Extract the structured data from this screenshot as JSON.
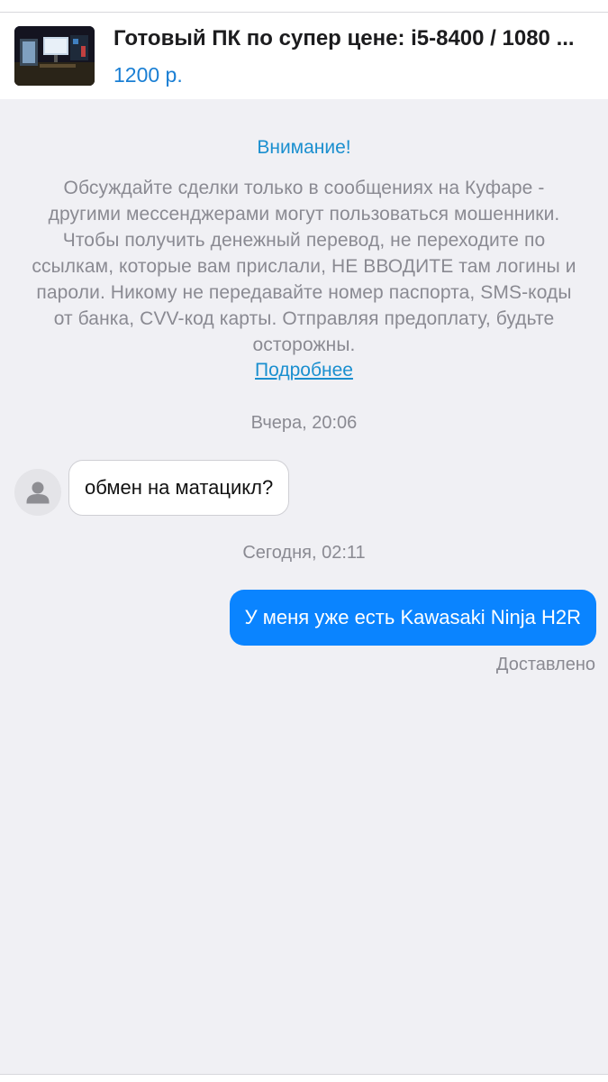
{
  "header": {
    "title": "Готовый ПК по супер цене: i5-8400 / 1080 ...",
    "price": "1200 р.",
    "thumbnail_icon": "listing-photo"
  },
  "notice": {
    "title": "Внимание!",
    "body": "Обсуждайте сделки только в сообщениях на Куфаре - другими мессенджерами могут пользоваться мошенники. Чтобы получить денежный перевод, не переходите по ссылкам, которые вам прислали, НЕ ВВОДИТЕ там логины и пароли. Никому не передавайте номер паспорта, SMS-коды от банка, CVV-код карты. Отправляя предоплату, будьте осторожны.",
    "more_link": "Подробнее"
  },
  "chat": {
    "timestamp_1": "Вчера, 20:06",
    "incoming_message": "обмен на матацикл?",
    "avatar_icon": "user-icon",
    "timestamp_2": "Сегодня, 02:11",
    "outgoing_message": "У меня уже есть Kawasaki Ninja H2R",
    "status": "Доставлено"
  },
  "colors": {
    "accent": "#1a8fcf",
    "price": "#1a7fd4",
    "outgoing_bubble": "#0a84ff",
    "background": "#f0f0f4",
    "muted_text": "#8a8a92"
  }
}
